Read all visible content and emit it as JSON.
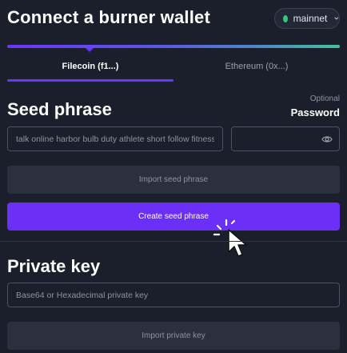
{
  "header": {
    "title": "Connect a burner wallet"
  },
  "network": {
    "label": "mainnet",
    "status_color": "#36c77a"
  },
  "tabs": [
    {
      "label": "Filecoin (f1...)",
      "active": true
    },
    {
      "label": "Ethereum (0x...)",
      "active": false
    }
  ],
  "seed": {
    "heading": "Seed phrase",
    "value": "talk online harbor bulb duty athlete short follow fitness",
    "optional_label": "Optional",
    "password_label": "Password",
    "password_value": "",
    "import_label": "Import seed phrase",
    "create_label": "Create seed phrase"
  },
  "private_key": {
    "heading": "Private key",
    "placeholder": "Base64 or Hexadecimal private key",
    "import_label": "Import private key"
  },
  "colors": {
    "accent": "#6b2ff8",
    "background": "#1b1f2b"
  }
}
